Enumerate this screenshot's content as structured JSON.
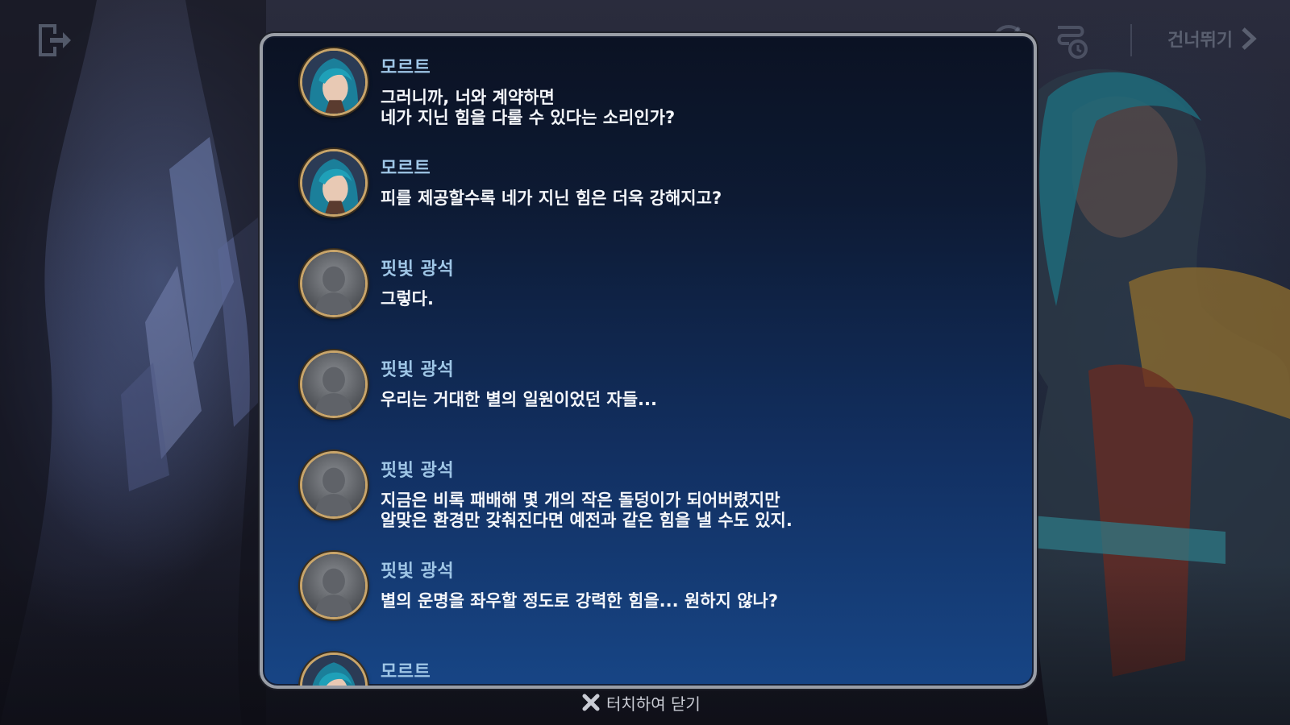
{
  "top_bar": {
    "skip_label": "건너뛰기"
  },
  "dialogue_log": {
    "entries": [
      {
        "speaker": "모르트",
        "lines": [
          "그러니까, 너와 계약하면",
          "네가 지닌 힘을 다룰 수 있다는 소리인가?"
        ],
        "avatar": "morte"
      },
      {
        "speaker": "모르트",
        "lines": [
          "피를 제공할수록 네가 지닌 힘은 더욱 강해지고?"
        ],
        "avatar": "morte"
      },
      {
        "speaker": "핏빛 광석",
        "lines": [
          "그렇다."
        ],
        "avatar": "silhouette"
      },
      {
        "speaker": "핏빛 광석",
        "lines": [
          "우리는 거대한 별의 일원이었던 자들..."
        ],
        "avatar": "silhouette"
      },
      {
        "speaker": "핏빛 광석",
        "lines": [
          "지금은 비록 패배해 몇 개의 작은 돌덩이가 되어버렸지만",
          "알맞은 환경만 갖춰진다면 예전과 같은 힘을 낼 수도 있지."
        ],
        "avatar": "silhouette"
      },
      {
        "speaker": "핏빛 광석",
        "lines": [
          "별의 운명을 좌우할 정도로 강력한 힘을... 원하지 않나?"
        ],
        "avatar": "silhouette"
      },
      {
        "speaker": "모르트",
        "lines": [],
        "avatar": "morte"
      }
    ]
  },
  "close_hint": "터치하여 닫기",
  "colors": {
    "speaker_name": "#9fc6e6",
    "dialogue_text": "#f4f6fa",
    "panel_border": "#9a9ea6",
    "avatar_ring": "#c9a56a"
  },
  "icons": {
    "exit": "exit-door-icon",
    "auto": "auto-play-icon",
    "log": "log-history-icon",
    "skip": "chevron-right-icon",
    "close": "close-x-icon"
  }
}
